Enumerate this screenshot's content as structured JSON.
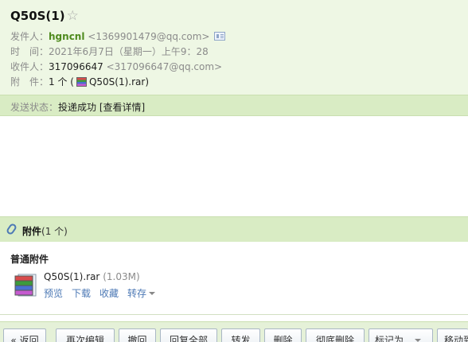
{
  "mail": {
    "subject": "Q50S(1)",
    "star": "☆",
    "sender_label": "发件人：",
    "sender_name": "hgncnl",
    "sender_email": "<1369901479@qq.com>",
    "time_label": "时　间：",
    "time_value": "2021年6月7日（星期一）上午9：28",
    "recipient_label": "收件人：",
    "recipient_name": "317096647",
    "recipient_email": "<317096647@qq.com>",
    "attach_label": "附　件：",
    "attach_count": "1 个 (",
    "attach_file": "Q50S(1).rar",
    "attach_close": ")"
  },
  "status": {
    "label": "发送状态：",
    "value": "投递成功",
    "details": "[查看详情]"
  },
  "attachments": {
    "header_title": "附件",
    "header_count": "(1 个)",
    "section": "普通附件",
    "file": {
      "name": "Q50S(1).rar",
      "size": "(1.03M)",
      "actions": [
        "预览",
        "下载",
        "收藏",
        "转存"
      ]
    }
  },
  "toolbar": {
    "buttons": [
      "« 返回",
      "再次编辑",
      "撤回",
      "回复全部",
      "转发",
      "删除",
      "彻底删除",
      "标记为...",
      "移动到..."
    ]
  }
}
